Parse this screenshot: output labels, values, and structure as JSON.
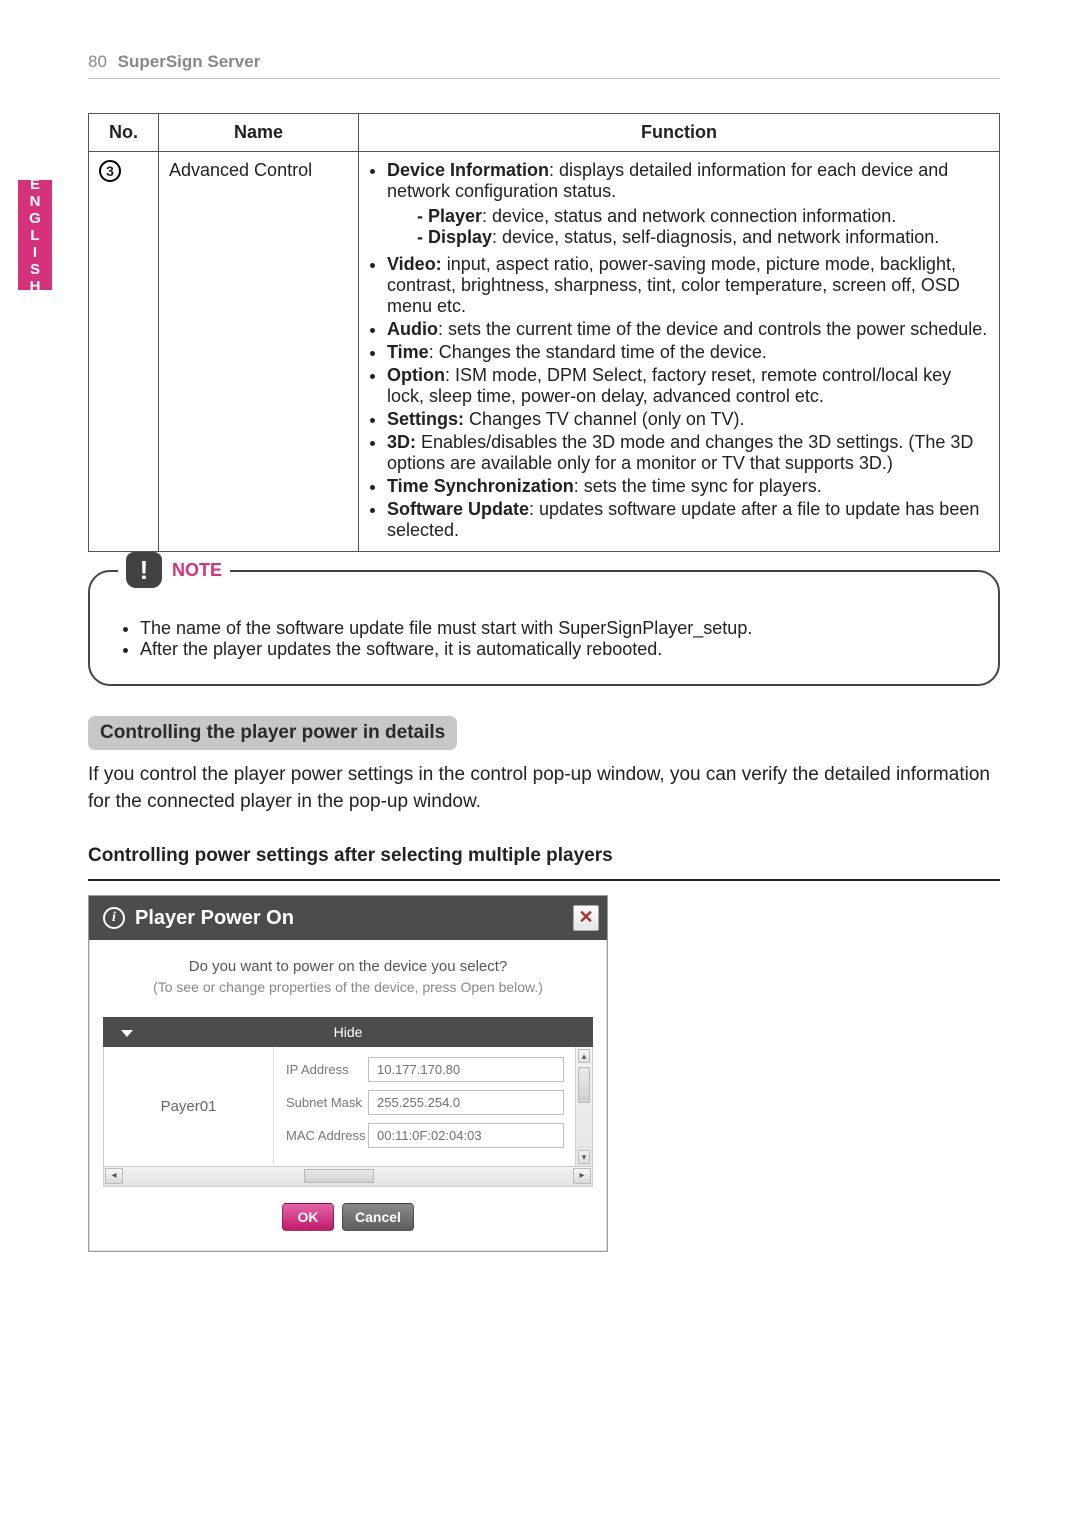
{
  "page": {
    "number": "80",
    "header": "SuperSign Server",
    "language_tab": "ENGLISH"
  },
  "table": {
    "headers": {
      "no": "No.",
      "name": "Name",
      "func": "Function"
    },
    "row": {
      "no": "3",
      "name": "Advanced Control",
      "devinfo_label": "Device Information",
      "devinfo_text": ": displays detailed information for each device and network configuration status.",
      "sub_player_label": "Player",
      "sub_player_text": ": device, status and network connection information.",
      "sub_display_label": "Display",
      "sub_display_text": ": device, status, self-diagnosis, and network information.",
      "video_label": "Video:",
      "video_text": " input, aspect ratio, power-saving mode, picture mode, backlight, contrast, brightness, sharpness, tint, color temperature, screen off, OSD menu etc.",
      "audio_label": "Audio",
      "audio_text": ": sets the current time of the device and controls the power schedule.",
      "time_label": "Time",
      "time_text": ": Changes the standard time of the device.",
      "option_label": "Option",
      "option_text": ": ISM mode, DPM Select, factory reset, remote control/local key lock, sleep time, power-on delay, advanced control etc.",
      "settings_label": "Settings:",
      "settings_text": " Changes TV channel (only on TV).",
      "threeD_label": "3D:",
      "threeD_text": " Enables/disables the 3D mode and changes the 3D settings. (The 3D options are available only for a monitor or TV that supports 3D.)",
      "timesync_label": "Time Synchronization",
      "timesync_text": ": sets the time sync for players.",
      "swupdate_label": "Software Update",
      "swupdate_text": ": updates software update after a file to update has been selected."
    }
  },
  "note": {
    "title": "NOTE",
    "items": [
      "The name of the software update file must start with SuperSignPlayer_setup.",
      "After the player updates the software, it is automatically rebooted."
    ]
  },
  "section": {
    "pill": "Controlling the player power in details",
    "body": "If you control the player power settings in the control pop-up window, you can verify the detailed information for the connected player in the pop-up window.",
    "subhead": "Controlling power settings after selecting multiple players"
  },
  "dialog": {
    "title": "Player Power On",
    "msg1": "Do you want to power on the device you select?",
    "msg2": "(To see or change properties of the device, press Open below.)",
    "hide": "Hide",
    "player_name": "Payer01",
    "rows": {
      "ip_label": "IP Address",
      "ip_value": "10.177.170.80",
      "subnet_label": "Subnet Mask",
      "subnet_value": "255.255.254.0",
      "mac_label": "MAC Address",
      "mac_value": "00:11:0F:02:04:03"
    },
    "ok": "OK",
    "cancel": "Cancel",
    "close_glyph": "✕"
  }
}
